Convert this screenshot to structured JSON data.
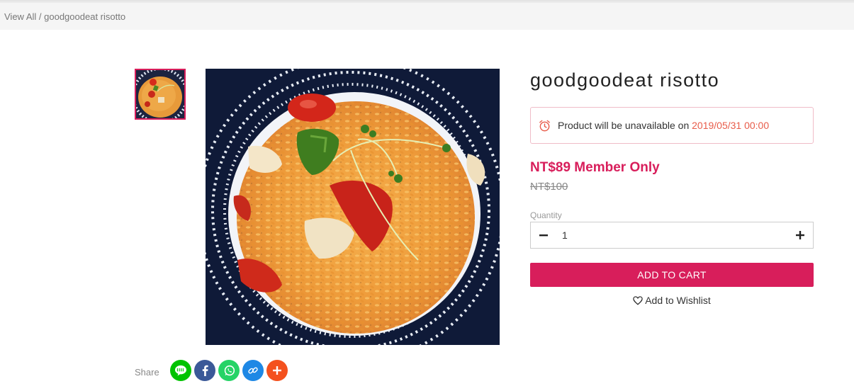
{
  "breadcrumb": {
    "root": "View All",
    "separator": " / ",
    "current": "goodgoodeat risotto"
  },
  "product": {
    "title": "goodgoodeat risotto",
    "image_alt": "risotto with tomatoes, peppers, chicken and microgreens in a striped bowl",
    "notice_prefix": "Product will be unavailable on ",
    "notice_date": "2019/05/31 00:00",
    "notice_icon": "alarm-clock-icon",
    "price": "NT$89 Member Only",
    "original_price": "NT$100"
  },
  "quantity": {
    "label": "Quantity",
    "value": "1",
    "minus_icon": "minus-icon",
    "plus_icon": "plus-icon"
  },
  "actions": {
    "add_to_cart": "ADD TO CART",
    "wishlist": "Add to Wishlist",
    "wishlist_icon": "heart-outline-icon"
  },
  "share": {
    "label": "Share",
    "buttons": [
      {
        "name": "line",
        "icon": "line-icon",
        "color": "#00c300"
      },
      {
        "name": "facebook",
        "icon": "facebook-icon",
        "color": "#3b5998"
      },
      {
        "name": "whatsapp",
        "icon": "whatsapp-icon",
        "color": "#25d366"
      },
      {
        "name": "copy-link",
        "icon": "link-icon",
        "color": "#1e88e5"
      },
      {
        "name": "more",
        "icon": "plus-icon",
        "color": "#f4511e"
      }
    ]
  },
  "colors": {
    "accent": "#d81e5b",
    "notice_border": "#f0bcc8",
    "notice_date": "#e85c4a"
  }
}
